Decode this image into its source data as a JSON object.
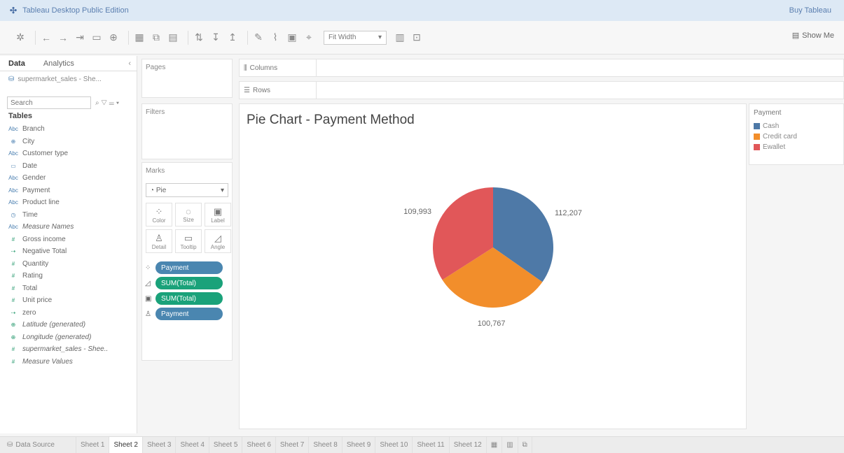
{
  "app": {
    "title": "Tableau Desktop Public Edition",
    "buy": "Buy Tableau"
  },
  "toolbar": {
    "fit_label": "Fit Width",
    "show_me": "Show Me"
  },
  "left": {
    "tabs": [
      "Data",
      "Analytics"
    ],
    "datasource": "supermarket_sales - She...",
    "search_placeholder": "Search",
    "tables_heading": "Tables",
    "fields": [
      {
        "name": "Branch",
        "icon": "Abc",
        "kind": "dim"
      },
      {
        "name": "City",
        "icon": "globe",
        "kind": "dim"
      },
      {
        "name": "Customer type",
        "icon": "Abc",
        "kind": "dim"
      },
      {
        "name": "Date",
        "icon": "calendar",
        "kind": "dim"
      },
      {
        "name": "Gender",
        "icon": "Abc",
        "kind": "dim"
      },
      {
        "name": "Payment",
        "icon": "Abc",
        "kind": "dim"
      },
      {
        "name": "Product line",
        "icon": "Abc",
        "kind": "dim"
      },
      {
        "name": "Time",
        "icon": "clock",
        "kind": "dim"
      },
      {
        "name": "Measure Names",
        "icon": "Abc",
        "kind": "dim",
        "italic": true
      },
      {
        "name": "Gross income",
        "icon": "#",
        "kind": "meas"
      },
      {
        "name": "Negative Total",
        "icon": "calc",
        "kind": "meas"
      },
      {
        "name": "Quantity",
        "icon": "#",
        "kind": "meas"
      },
      {
        "name": "Rating",
        "icon": "#",
        "kind": "meas"
      },
      {
        "name": "Total",
        "icon": "#",
        "kind": "meas"
      },
      {
        "name": "Unit price",
        "icon": "#",
        "kind": "meas"
      },
      {
        "name": "zero",
        "icon": "calc",
        "kind": "meas"
      },
      {
        "name": "Latitude (generated)",
        "icon": "globe",
        "kind": "meas",
        "italic": true
      },
      {
        "name": "Longitude (generated)",
        "icon": "globe",
        "kind": "meas",
        "italic": true
      },
      {
        "name": "supermarket_sales - Shee..",
        "icon": "#",
        "kind": "meas",
        "italic": true
      },
      {
        "name": "Measure Values",
        "icon": "#",
        "kind": "meas",
        "italic": true
      }
    ]
  },
  "shelves": {
    "pages": "Pages",
    "filters": "Filters",
    "marks": "Marks",
    "mark_type": "Pie",
    "mark_buttons": [
      "Color",
      "Size",
      "Label",
      "Detail",
      "Tooltip",
      "Angle"
    ],
    "pills": [
      {
        "label": "Payment",
        "kind": "dim",
        "icon": "color"
      },
      {
        "label": "SUM(Total)",
        "kind": "meas",
        "icon": "angle"
      },
      {
        "label": "SUM(Total)",
        "kind": "meas",
        "icon": "label"
      },
      {
        "label": "Payment",
        "kind": "dim",
        "icon": "detail"
      }
    ],
    "columns": "Columns",
    "rows": "Rows"
  },
  "chart_data": {
    "type": "pie",
    "title": "Pie Chart - Payment Method",
    "legend_title": "Payment",
    "legend_position": "right",
    "series": [
      {
        "name": "Cash",
        "value": 112207,
        "label": "112,207",
        "color": "#4e79a7"
      },
      {
        "name": "Credit card",
        "value": 100767,
        "label": "100,767",
        "color": "#f28e2b"
      },
      {
        "name": "Ewallet",
        "value": 109993,
        "label": "109,993",
        "color": "#e15759"
      }
    ]
  },
  "sheets": {
    "datasource_tab": "Data Source",
    "tabs": [
      "Sheet 1",
      "Sheet 2",
      "Sheet 3",
      "Sheet 4",
      "Sheet 5",
      "Sheet 6",
      "Sheet 7",
      "Sheet 8",
      "Sheet 9",
      "Sheet 10",
      "Sheet 11",
      "Sheet 12"
    ],
    "active": "Sheet 2"
  }
}
